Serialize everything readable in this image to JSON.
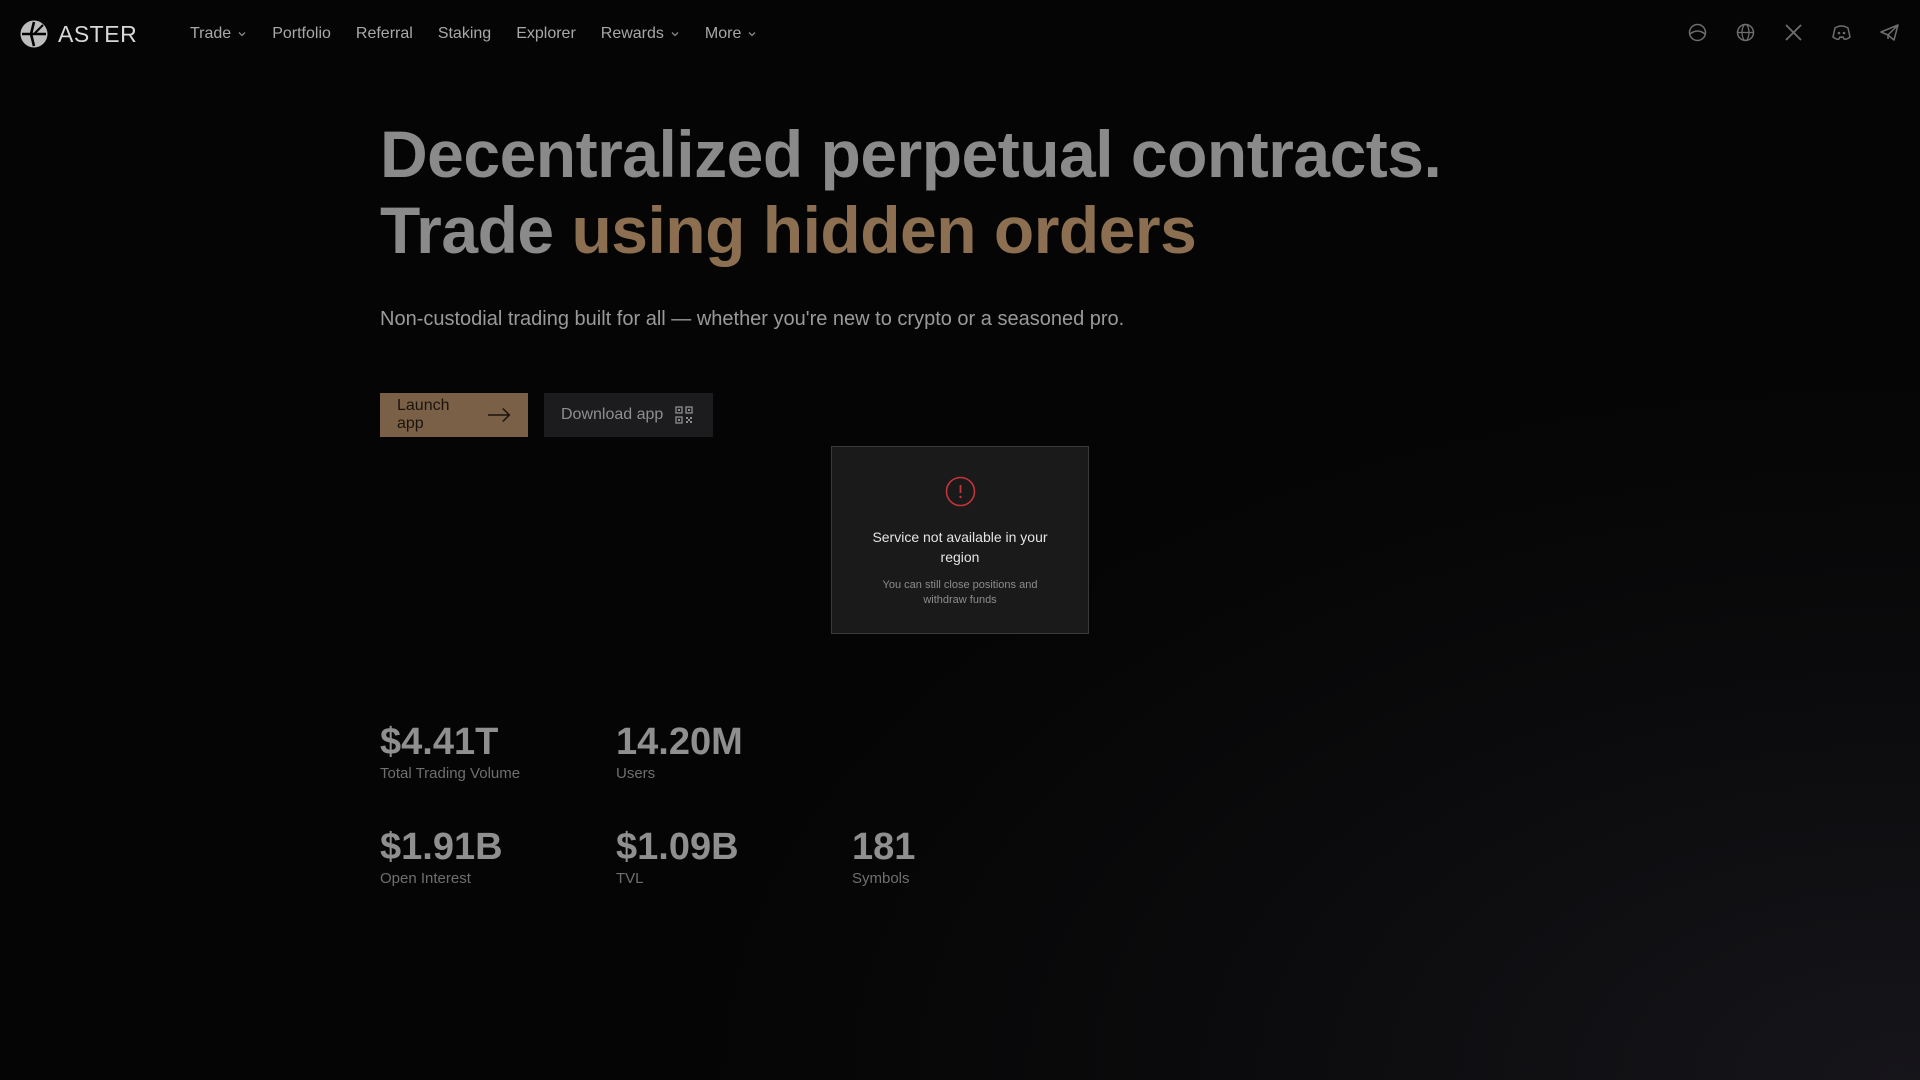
{
  "brand": {
    "name": "ASTER"
  },
  "nav": {
    "items": [
      {
        "label": "Trade",
        "has_dropdown": true
      },
      {
        "label": "Portfolio",
        "has_dropdown": false
      },
      {
        "label": "Referral",
        "has_dropdown": false
      },
      {
        "label": "Staking",
        "has_dropdown": false
      },
      {
        "label": "Explorer",
        "has_dropdown": false
      },
      {
        "label": "Rewards",
        "has_dropdown": true
      },
      {
        "label": "More",
        "has_dropdown": true
      }
    ],
    "icons": [
      "theme-icon",
      "globe-icon",
      "x-icon",
      "discord-icon",
      "telegram-icon"
    ]
  },
  "hero": {
    "title_line1": "Decentralized perpetual contracts.",
    "title_line2_plain": "Trade ",
    "title_line2_accent": "using hidden orders",
    "subtitle": "Non-custodial trading built for all — whether you're new to crypto or a seasoned pro."
  },
  "buttons": {
    "launch_label": "Launch app",
    "download_label": "Download app"
  },
  "stats": [
    {
      "value": "$4.41T",
      "label": "Total Trading Volume"
    },
    {
      "value": "14.20M",
      "label": "Users"
    },
    {
      "value": "$1.91B",
      "label": "Open Interest"
    },
    {
      "value": "$1.09B",
      "label": "TVL"
    },
    {
      "value": "181",
      "label": "Symbols"
    }
  ],
  "modal": {
    "icon": "alert-icon",
    "title": "Service not available in your region",
    "description": "You can still close positions and withdraw funds"
  },
  "colors": {
    "accent": "#8c6f51",
    "button_accent": "#7a6046",
    "alert": "#c4343b",
    "background": "#000000"
  }
}
